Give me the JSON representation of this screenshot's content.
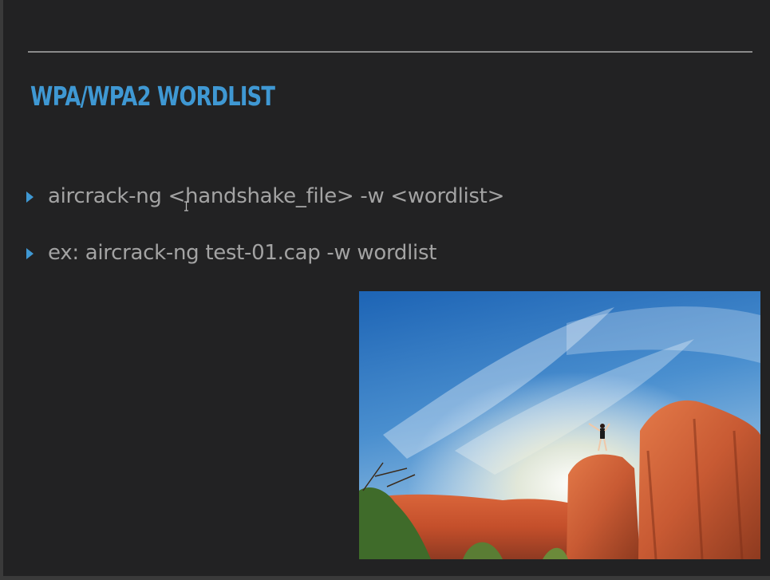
{
  "slide": {
    "title": "WPA/WPA2 WORDLIST",
    "bullets": [
      "aircrack-ng <handshake_file> -w <wordlist>",
      "ex: aircrack-ng test-01.cap -w wordlist"
    ]
  },
  "icons": {
    "bullet": "triangle-bullet-icon",
    "cursor": "text-cursor-icon"
  },
  "colors": {
    "background": "#222223",
    "accent": "#3f98d3",
    "text": "#a3a3a3",
    "rule": "#8a8a8a"
  }
}
